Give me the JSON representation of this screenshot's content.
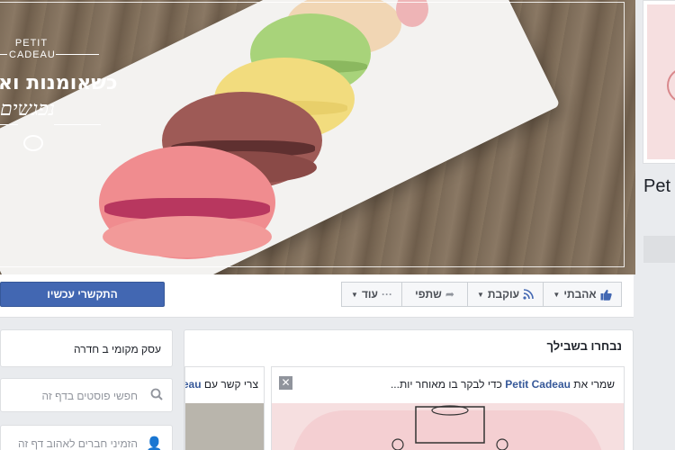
{
  "cover": {
    "logo_small_line1": "PETIT",
    "logo_small_line2": "CADEAU",
    "logo_hebrew": "כשאומנות וא",
    "logo_script": "נפגשים"
  },
  "profile": {
    "name_partial": "Pet"
  },
  "action_bar": {
    "contact_button": "התקשרי עכשיו",
    "like_button": "אהבתי",
    "follow_button": "עוקבת",
    "share_button": "שתפי",
    "more_button": "עוד",
    "more_dots": "···"
  },
  "left_column": {
    "local_business": "עסק מקומי ב חדרה",
    "search_placeholder": "חפשי פוסטים בדף זה",
    "invite_text": "הזמיני חברים לאהוב דף זה"
  },
  "suggested": {
    "title": "נבחרו בשבילך",
    "card1_prefix": "שמרי את",
    "card1_page": "Petit Cadeau",
    "card1_suffix": "כדי לבקר בו מאוחר יות...",
    "card2_prefix": "צרי קשר עם",
    "card2_page": "Petit Cadeau",
    "close_glyph": "✕"
  },
  "colors": {
    "brand_blue": "#4267b2",
    "link_blue": "#365899",
    "page_bg": "#e9ebee"
  }
}
